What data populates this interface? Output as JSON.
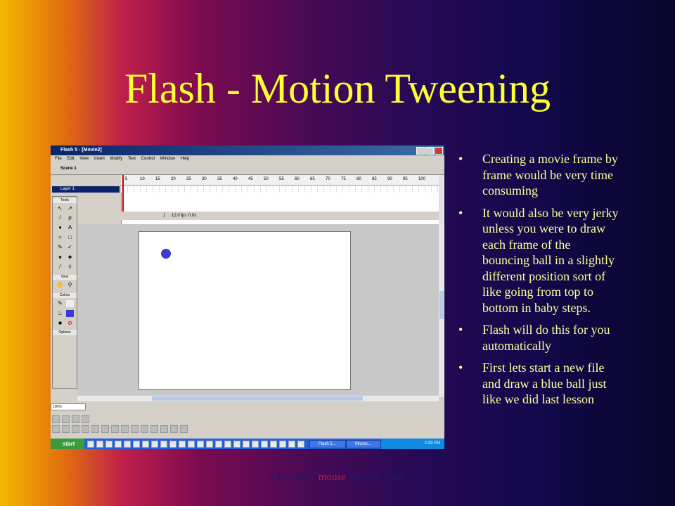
{
  "title": "Flash -  Motion Tweening",
  "screenshot": {
    "window_title": "Flash 5 - [Movie2]",
    "menu": [
      "File",
      "Edit",
      "View",
      "Insert",
      "Modify",
      "Text",
      "Control",
      "Window",
      "Help"
    ],
    "scene": "Scene 1",
    "layer": "Layer 1",
    "ruler": [
      "5",
      "10",
      "15",
      "20",
      "25",
      "30",
      "35",
      "40",
      "45",
      "50",
      "55",
      "60",
      "65",
      "70",
      "75",
      "80",
      "85",
      "90",
      "95",
      "100"
    ],
    "frame_num": "1",
    "fps": "12.0 fps",
    "time": "0.0s",
    "toolbox": {
      "tools": "Tools",
      "view": "View",
      "colors": "Colors",
      "options": "Options"
    },
    "zoom": "100%",
    "taskbar": {
      "start": "start",
      "task1": "Flash 5...",
      "task2": "Micros...",
      "clock": "2:33 PM"
    }
  },
  "bullets": [
    "Creating a movie frame by frame would be very time consuming",
    "It would also be very jerky unless you were to draw each frame of the bouncing ball in a slightly different position sort of like going from top to bottom in baby steps.",
    "Flash will do this for you automatically",
    "First lets start a new file and draw a blue ball just like we did last lesson"
  ],
  "footer": {
    "pre": "Click your ",
    "mouse": "mouse",
    "post": " for next slide"
  },
  "colors": {
    "title": "#ffff33",
    "bullet_text": "#ffff99",
    "ball": "#3a3ad0",
    "mouse_link": "#c0143c"
  }
}
